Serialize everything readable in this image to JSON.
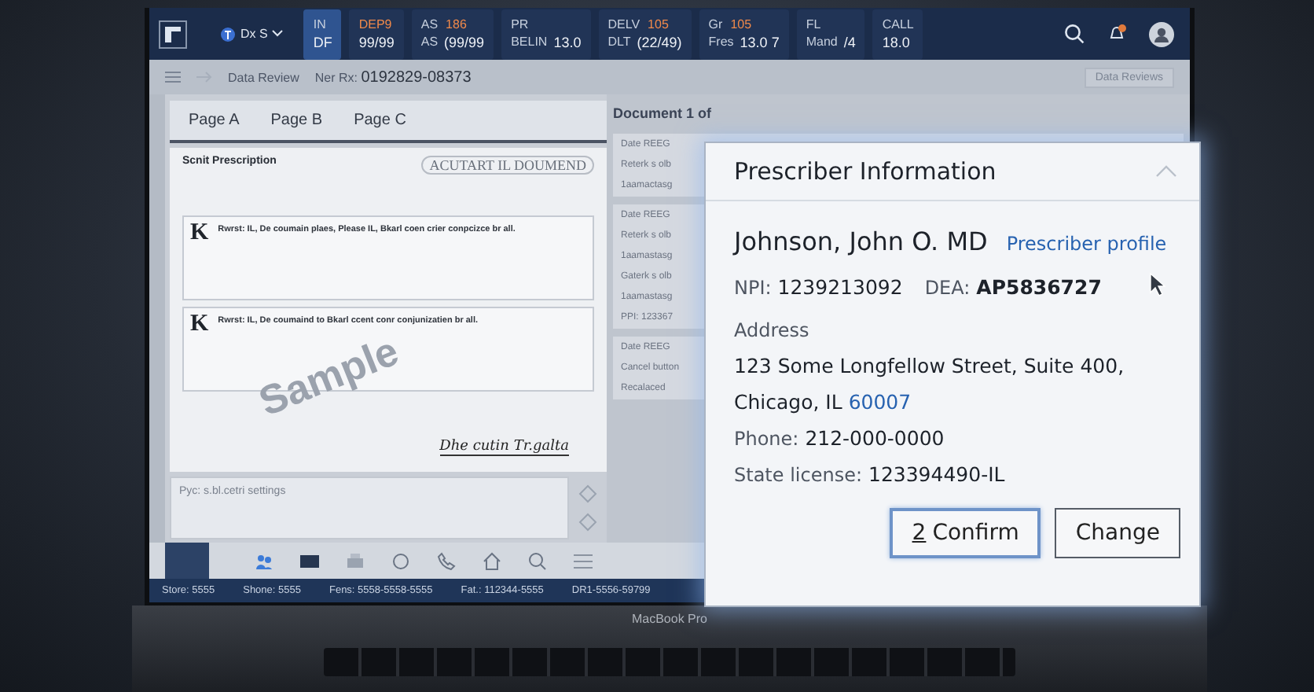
{
  "top_bar": {
    "profile": {
      "label": "Dx S"
    },
    "segments": [
      {
        "title": "IN",
        "value": "DF",
        "selected": true
      },
      {
        "badge": "DEP9",
        "value": "99/99",
        "selected": false
      },
      {
        "title": "AS",
        "badge": "186",
        "sub": "AS",
        "value": "(99/99",
        "selected": false
      },
      {
        "title": "PR",
        "sub": "BELIN",
        "value": "13.0",
        "selected": false
      },
      {
        "title": "DELV",
        "badge": "105",
        "sub": "DLT",
        "value": "(22/49)",
        "selected": false
      },
      {
        "title": "Gr",
        "badge": "105",
        "sub": "Fres",
        "value": "13.0 7",
        "selected": false
      },
      {
        "title": "FL",
        "sub": "Mand",
        "value": "/4",
        "selected": false
      },
      {
        "title": "CALL",
        "value": "18.0",
        "selected": false
      }
    ]
  },
  "breadcrumb": {
    "section": "Data Review",
    "record_label": "Ner Rx:",
    "record": "0192829-08373",
    "right_button": "Data Reviews"
  },
  "page_tabs": [
    {
      "label": "Page A"
    },
    {
      "label": "Page B"
    },
    {
      "label": "Page C"
    }
  ],
  "document": {
    "title": "Scnit Prescription",
    "letterhead": "ACUTART IL DOUMEND",
    "entries": [
      {
        "mark": "K",
        "heading": "Rwrst: IL, De coumain plaes, Please IL, Bkarl coen crier conpcizce br all."
      },
      {
        "mark": "K",
        "heading": "Rwrst: IL, De coumaind to Bkarl ccent conr conjunizatien br all."
      }
    ],
    "stamp": "Sample",
    "signature": "Dhe cutin Tr.galta"
  },
  "notes": {
    "placeholder": "Pyc: s.bl.cetri settings"
  },
  "status_bar": [
    "Store: 5555",
    "Shone: 5555",
    "Fens: 5558-5558-5555",
    "Fat.: 112344-5555",
    "DR1-5556-59799"
  ],
  "documents_panel": {
    "heading": "Document 1 of",
    "cards": [
      {
        "lines": [
          "Date REEG",
          "Reterk s olb",
          "1aamactasg"
        ]
      },
      {
        "lines": [
          "Date REEG",
          "Reterk s olb",
          "1aamastasg",
          "Gaterk s olb",
          "1aamastasg",
          "PPI: 123367"
        ]
      },
      {
        "lines": [
          "Date REEG",
          "Cancel button",
          "Recalaced"
        ]
      }
    ]
  },
  "popup": {
    "title": "Prescriber Information",
    "name": "Johnson, John O. MD",
    "profile_link": "Prescriber profile",
    "npi_label": "NPI:",
    "npi": "1239213092",
    "dea_label": "DEA:",
    "dea": "AP5836727",
    "address_label": "Address",
    "address_line": "123 Some Longfellow Street, Suite 400,",
    "city": "Chicago, IL",
    "zip": "60007",
    "phone_label": "Phone:",
    "phone": "212-000-0000",
    "license_label": "State license:",
    "license": "123394490-IL",
    "buttons": [
      {
        "kind": "primary",
        "shortcut": "2",
        "label": "Confirm"
      },
      {
        "kind": "secondary",
        "label": "Change"
      }
    ]
  },
  "laptop": {
    "brand": "MacBook Pro"
  }
}
